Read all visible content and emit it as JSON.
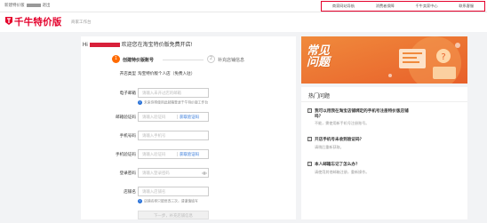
{
  "topbar": {
    "left_prefix": "新建特价版",
    "left_suffix": "退出",
    "nav": [
      "商家网站导航",
      "消费者保障",
      "千牛卖家中心",
      "联系客服"
    ]
  },
  "header": {
    "brand": "千牛特价版",
    "subbrand": "商家工作台"
  },
  "form": {
    "welcome_prefix": "Hi",
    "welcome_text": "欢迎您在淘宝特价版免费开店!",
    "steps": [
      {
        "num": "1",
        "label": "创建特价版账号"
      },
      {
        "num": "2",
        "label": "补充店铺信息"
      }
    ],
    "shop_type": {
      "label": "开店类型",
      "value": "淘宝特价版个人店（免费入驻）"
    },
    "email": {
      "label": "电子邮箱",
      "placeholder": "请输入未开过店的邮箱"
    },
    "email_hint": "未来你将使用此邮箱登录千牛特价版工作台",
    "email_code": {
      "label": "邮箱验证码",
      "placeholder": "请输入验证码",
      "action": "获取验证码"
    },
    "phone": {
      "label": "手机号码",
      "placeholder": "请输入手机号"
    },
    "phone_code": {
      "label": "手机验证码",
      "placeholder": "请输入验证码",
      "action": "获取验证码"
    },
    "password": {
      "label": "登录密码",
      "placeholder": "请输入登录密码"
    },
    "shop_name": {
      "label": "店铺名",
      "placeholder": "请输入店铺名"
    },
    "shop_hint": "店铺名称只能修改三次，请谨慎填写",
    "next_button": "下一步，补充店铺信息"
  },
  "banner": {
    "title": "常见问题"
  },
  "faq": {
    "title": "热门问题",
    "items": [
      {
        "q": "我可以用我在淘宝店铺绑定的手机号注册特价版店铺吗？",
        "a": "不能，需使用新手机号注册账号。"
      },
      {
        "q": "开店手机号未收到验证码？",
        "a": "请稍后重新获取。"
      },
      {
        "q": "本人邮箱忘记了怎么办？",
        "a": "请使用其他邮箱注册，重新操作。"
      }
    ]
  },
  "colors": {
    "brand_red": "#e4002b",
    "accent_orange": "#ff6a00",
    "link_blue": "#2b73d8"
  }
}
